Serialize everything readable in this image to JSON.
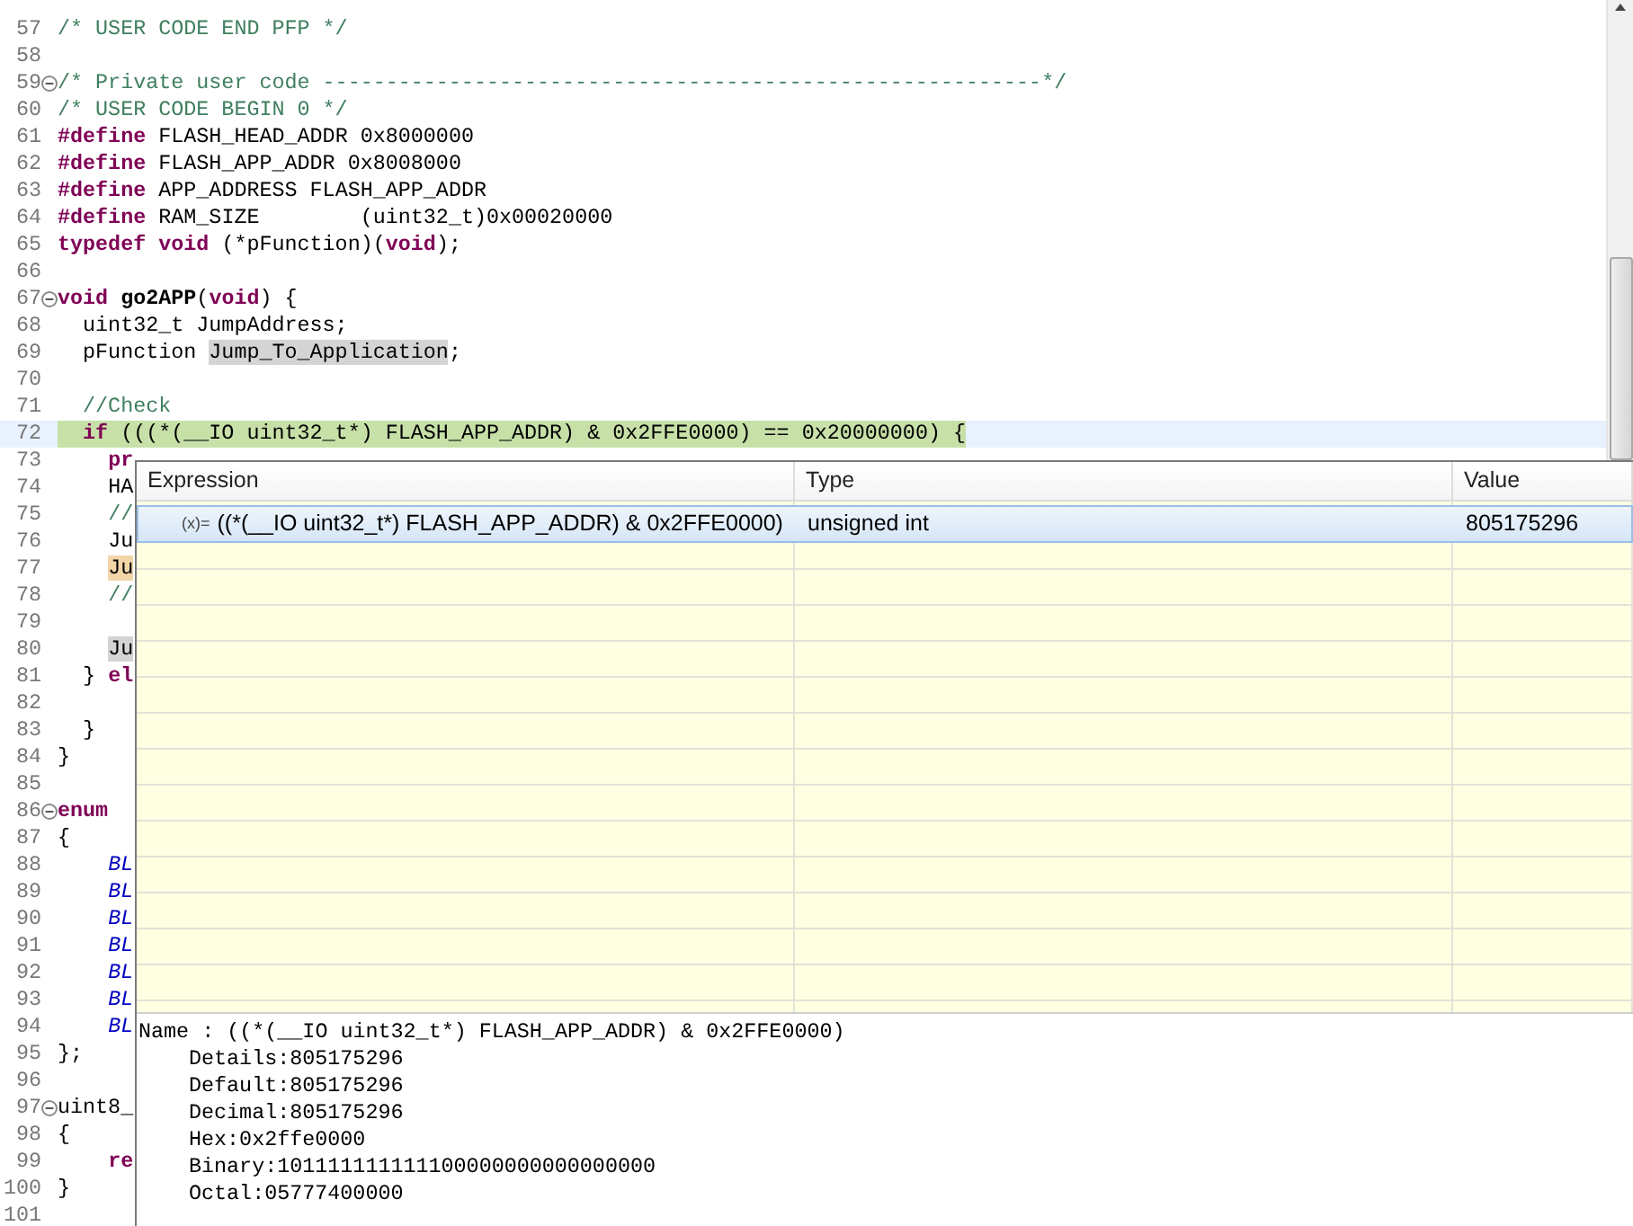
{
  "editor": {
    "lines": [
      {
        "number": "57",
        "foldable": false,
        "current": false,
        "segments": [
          {
            "text": "/* USER CODE END PFP */",
            "kind": "comment"
          }
        ]
      },
      {
        "number": "58",
        "foldable": false,
        "current": false
      },
      {
        "number": "59",
        "foldable": true,
        "current": false,
        "segments": [
          {
            "text": "/* Private user code ---------------------------------------------------------*/",
            "kind": "comment"
          }
        ]
      },
      {
        "number": "60",
        "foldable": false,
        "current": false,
        "segments": [
          {
            "text": "/* USER CODE BEGIN 0 */",
            "kind": "comment"
          }
        ]
      },
      {
        "number": "61",
        "foldable": false,
        "current": false,
        "segments": [
          {
            "text": "#define",
            "kind": "keyword"
          },
          {
            "text": " FLASH_HEAD_ADDR 0x8000000",
            "kind": "plain"
          }
        ]
      },
      {
        "number": "62",
        "foldable": false,
        "current": false,
        "segments": [
          {
            "text": "#define",
            "kind": "keyword"
          },
          {
            "text": " FLASH_APP_ADDR 0x8008000",
            "kind": "plain"
          }
        ]
      },
      {
        "number": "63",
        "foldable": false,
        "current": false,
        "segments": [
          {
            "text": "#define",
            "kind": "keyword"
          },
          {
            "text": " APP_ADDRESS FLASH_APP_ADDR",
            "kind": "plain"
          }
        ]
      },
      {
        "number": "64",
        "foldable": false,
        "current": false,
        "segments": [
          {
            "text": "#define",
            "kind": "keyword"
          },
          {
            "text": " RAM_SIZE        (uint32_t)0x00020000",
            "kind": "plain"
          }
        ]
      },
      {
        "number": "65",
        "foldable": false,
        "current": false,
        "segments": [
          {
            "text": "typedef void",
            "kind": "keyword"
          },
          {
            "text": " (*pFunction)(",
            "kind": "plain"
          },
          {
            "text": "void",
            "kind": "keyword"
          },
          {
            "text": ");",
            "kind": "plain"
          }
        ]
      },
      {
        "number": "66",
        "foldable": false,
        "current": false
      },
      {
        "number": "67",
        "foldable": true,
        "current": false,
        "segments": [
          {
            "text": "void",
            "kind": "keyword"
          },
          {
            "text": " go2APP",
            "kind": "function"
          },
          {
            "text": "(",
            "kind": "plain"
          },
          {
            "text": "void",
            "kind": "keyword"
          },
          {
            "text": ") {",
            "kind": "plain"
          }
        ]
      },
      {
        "number": "68",
        "foldable": false,
        "current": false,
        "segments": [
          {
            "text": "  uint32_t JumpAddress;",
            "kind": "plain"
          }
        ]
      },
      {
        "number": "69",
        "foldable": false,
        "current": false,
        "segments": [
          {
            "text": "  pFunction ",
            "kind": "plain"
          },
          {
            "text": "Jump_To_Application",
            "kind": "occurrence"
          },
          {
            "text": ";",
            "kind": "plain"
          }
        ]
      },
      {
        "number": "70",
        "foldable": false,
        "current": false
      },
      {
        "number": "71",
        "foldable": false,
        "current": false,
        "segments": [
          {
            "text": "  //Check",
            "kind": "comment"
          }
        ]
      },
      {
        "number": "72",
        "foldable": false,
        "current": true,
        "segments": [
          {
            "text": "  if",
            "kind": "keyword"
          },
          {
            "text": " (((*(__IO uint32_t*) FLASH_APP_ADDR) & 0x2FFE0000) == 0x20000000) {",
            "kind": "plain"
          }
        ]
      },
      {
        "number": "73",
        "foldable": false,
        "current": false,
        "segments": [
          {
            "text": "    pr",
            "kind": "keyword"
          }
        ]
      },
      {
        "number": "74",
        "foldable": false,
        "current": false,
        "segments": [
          {
            "text": "    HA",
            "kind": "plain"
          }
        ]
      },
      {
        "number": "75",
        "foldable": false,
        "current": false,
        "segments": [
          {
            "text": "    //",
            "kind": "comment"
          }
        ]
      },
      {
        "number": "76",
        "foldable": false,
        "current": false,
        "segments": [
          {
            "text": "    Ju",
            "kind": "plain"
          }
        ]
      },
      {
        "number": "77",
        "foldable": false,
        "current": false,
        "segments": [
          {
            "text": "    Ju",
            "kind": "write-occurrence"
          }
        ]
      },
      {
        "number": "78",
        "foldable": false,
        "current": false,
        "segments": [
          {
            "text": "    //",
            "kind": "comment"
          }
        ]
      },
      {
        "number": "79",
        "foldable": false,
        "current": false
      },
      {
        "number": "80",
        "foldable": false,
        "current": false,
        "segments": [
          {
            "text": "    Ju",
            "kind": "occurrence"
          }
        ]
      },
      {
        "number": "81",
        "foldable": false,
        "current": false,
        "segments": [
          {
            "text": "  }",
            "kind": "plain"
          },
          {
            "text": " el",
            "kind": "keyword"
          }
        ]
      },
      {
        "number": "82",
        "foldable": false,
        "current": false
      },
      {
        "number": "83",
        "foldable": false,
        "current": false,
        "segments": [
          {
            "text": "  }",
            "kind": "plain"
          }
        ]
      },
      {
        "number": "84",
        "foldable": false,
        "current": false,
        "segments": [
          {
            "text": "}",
            "kind": "plain"
          }
        ]
      },
      {
        "number": "85",
        "foldable": false,
        "current": false
      },
      {
        "number": "86",
        "foldable": true,
        "current": false,
        "segments": [
          {
            "text": "enum",
            "kind": "keyword"
          }
        ]
      },
      {
        "number": "87",
        "foldable": false,
        "current": false,
        "segments": [
          {
            "text": "{",
            "kind": "plain"
          }
        ]
      },
      {
        "number": "88",
        "foldable": false,
        "current": false,
        "segments": [
          {
            "text": "    BL",
            "kind": "enumerator"
          }
        ]
      },
      {
        "number": "89",
        "foldable": false,
        "current": false,
        "segments": [
          {
            "text": "    BL",
            "kind": "enumerator"
          }
        ]
      },
      {
        "number": "90",
        "foldable": false,
        "current": false,
        "segments": [
          {
            "text": "    BL",
            "kind": "enumerator"
          }
        ]
      },
      {
        "number": "91",
        "foldable": false,
        "current": false,
        "segments": [
          {
            "text": "    BL",
            "kind": "enumerator"
          }
        ]
      },
      {
        "number": "92",
        "foldable": false,
        "current": false,
        "segments": [
          {
            "text": "    BL",
            "kind": "enumerator"
          }
        ]
      },
      {
        "number": "93",
        "foldable": false,
        "current": false,
        "segments": [
          {
            "text": "    BL",
            "kind": "enumerator"
          }
        ]
      },
      {
        "number": "94",
        "foldable": false,
        "current": false,
        "segments": [
          {
            "text": "    BL",
            "kind": "enumerator"
          }
        ]
      },
      {
        "number": "95",
        "foldable": false,
        "current": false,
        "segments": [
          {
            "text": "};",
            "kind": "plain"
          }
        ]
      },
      {
        "number": "96",
        "foldable": false,
        "current": false
      },
      {
        "number": "97",
        "foldable": true,
        "current": false,
        "segments": [
          {
            "text": "uint8_",
            "kind": "plain"
          }
        ]
      },
      {
        "number": "98",
        "foldable": false,
        "current": false,
        "segments": [
          {
            "text": "{",
            "kind": "plain"
          }
        ]
      },
      {
        "number": "99",
        "foldable": false,
        "current": false,
        "segments": [
          {
            "text": "    re",
            "kind": "keyword"
          }
        ]
      },
      {
        "number": "100",
        "foldable": false,
        "current": false,
        "segments": [
          {
            "text": "}",
            "kind": "plain"
          }
        ]
      },
      {
        "number": "101",
        "foldable": false,
        "current": false
      }
    ]
  },
  "expression_popup": {
    "columns": [
      "Expression",
      "Type",
      "Value"
    ],
    "rows": [
      {
        "icon_text": "(x)=",
        "expression": "((*(__IO uint32_t*) FLASH_APP_ADDR) & 0x2FFE0000)",
        "type": "unsigned int",
        "value": "805175296",
        "selected": true
      }
    ],
    "details": {
      "name_line": "Name : ((*(__IO uint32_t*) FLASH_APP_ADDR) & 0x2FFE0000)",
      "lines": [
        "Details:805175296",
        "Default:805175296",
        "Decimal:805175296",
        "Hex:0x2ffe0000",
        "Binary:101111111111100000000000000000",
        "Octal:05777400000"
      ]
    }
  }
}
